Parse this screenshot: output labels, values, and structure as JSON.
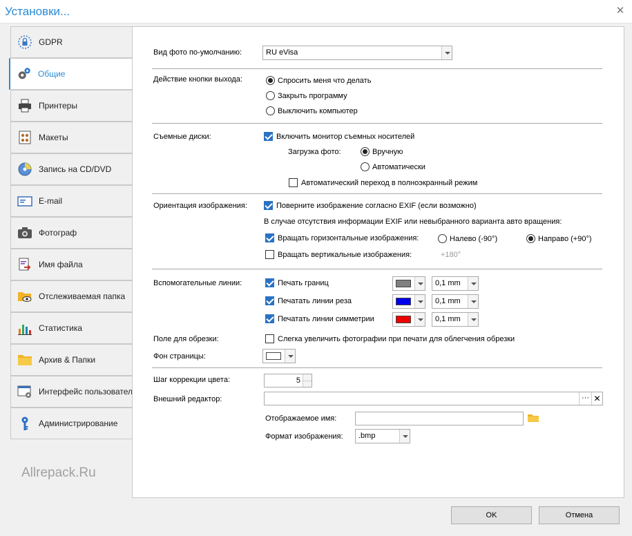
{
  "window": {
    "title": "Установки...",
    "close_glyph": "✕"
  },
  "sidebar": {
    "items": [
      {
        "label": "GDPR",
        "icon": "gdpr-lock-icon"
      },
      {
        "label": "Общие",
        "icon": "gears-icon",
        "active": true
      },
      {
        "label": "Принтеры",
        "icon": "printer-icon"
      },
      {
        "label": "Макеты",
        "icon": "layouts-icon"
      },
      {
        "label": "Запись на CD/DVD",
        "icon": "disc-icon"
      },
      {
        "label": "E-mail",
        "icon": "envelope-icon"
      },
      {
        "label": "Фотограф",
        "icon": "camera-icon"
      },
      {
        "label": "Имя файла",
        "icon": "file-rename-icon"
      },
      {
        "label": "Отслеживаемая папка",
        "icon": "watched-folder-icon"
      },
      {
        "label": "Статистика",
        "icon": "bar-chart-icon"
      },
      {
        "label": "Архив & Папки",
        "icon": "folder-icon"
      },
      {
        "label": "Интерфейс пользователя",
        "icon": "ui-settings-icon"
      },
      {
        "label": "Администрирование",
        "icon": "key-icon"
      }
    ],
    "watermark": "Allrepack.Ru"
  },
  "general": {
    "default_photo": {
      "label": "Вид фото по-умолчанию:",
      "value": "RU eVisa"
    },
    "exit_action": {
      "label": "Действие кнопки выхода:",
      "options": [
        {
          "label": "Спросить меня что делать",
          "selected": true
        },
        {
          "label": "Закрыть программу",
          "selected": false
        },
        {
          "label": "Выключить компьютер",
          "selected": false
        }
      ]
    },
    "removable": {
      "label": "Съемные диски:",
      "monitor": {
        "label": "Включить монитор съемных носителей",
        "checked": true
      },
      "upload_label": "Загрузка фото:",
      "upload_options": [
        {
          "label": "Вручную",
          "selected": true
        },
        {
          "label": "Автоматически",
          "selected": false
        }
      ],
      "fullscreen": {
        "label": "Автоматический переход в полноэкранный режим",
        "checked": false
      }
    },
    "orientation": {
      "label": "Ориентация изображения:",
      "exif": {
        "label": "Поверните изображение согласно EXIF (если возможно)",
        "checked": true
      },
      "note": "В случае отсутствия информации EXIF или невыбранного варианта авто вращения:",
      "horizontal": {
        "label": "Вращать горизонтальные изображения:",
        "checked": true
      },
      "left": {
        "label": "Налево (-90°)",
        "selected": false
      },
      "right": {
        "label": "Направо (+90°)",
        "selected": true
      },
      "vertical": {
        "label": "Вращать вертикальные изображения:",
        "checked": false
      },
      "vertical_value": "+180°"
    },
    "guides": {
      "label": "Вспомогательные линии:",
      "rows": [
        {
          "label": "Печать границ",
          "checked": true,
          "color": "#808080",
          "width": "0,1 mm"
        },
        {
          "label": "Печатать линии реза",
          "checked": true,
          "color": "#0000ee",
          "width": "0,1 mm"
        },
        {
          "label": "Печатать линии симметрии",
          "checked": true,
          "color": "#ee0000",
          "width": "0,1 mm"
        }
      ]
    },
    "trim": {
      "label": "Поле для обрезки:",
      "option": "Слегка увеличить фотографии при печати для облегчения обрезки",
      "checked": false
    },
    "background": {
      "label": "Фон страницы:",
      "color": "#ffffff"
    },
    "color_step": {
      "label": "Шаг коррекции цвета:",
      "value": "5"
    },
    "editor": {
      "label": "Внешний редактор:",
      "value": "",
      "browse": "···",
      "display_name_label": "Отображаемое имя:",
      "display_name": "",
      "format_label": "Формат изображения:",
      "format": ".bmp"
    }
  },
  "footer": {
    "ok": "OK",
    "cancel": "Отмена"
  }
}
